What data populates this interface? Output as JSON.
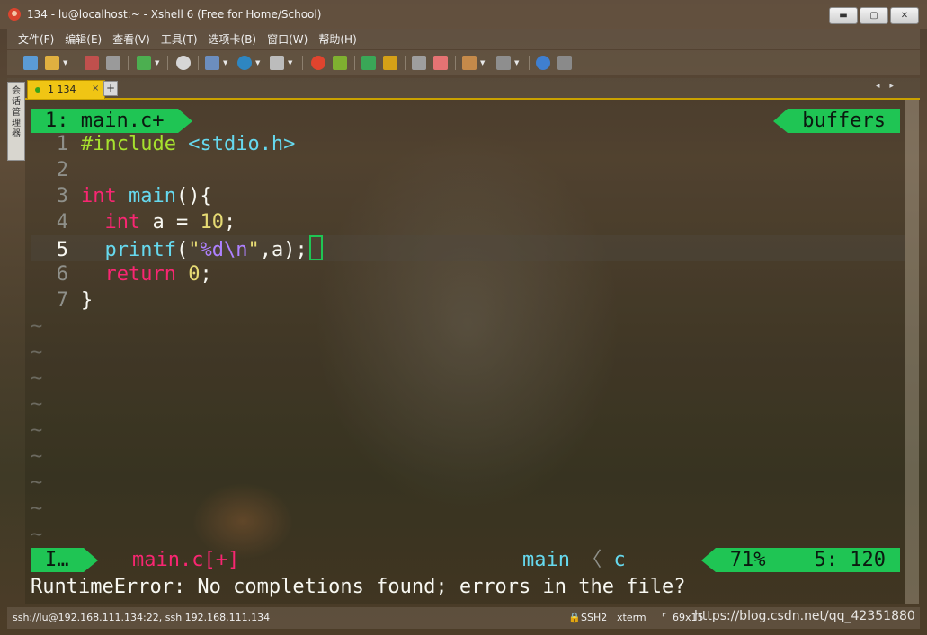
{
  "window": {
    "title": "134 - lu@localhost:~ - Xshell 6 (Free for Home/School)",
    "buttons": {
      "minimize": "▬",
      "maximize": "▢",
      "close": "✕"
    }
  },
  "menu": [
    "文件(F)",
    "编辑(E)",
    "查看(V)",
    "工具(T)",
    "选项卡(B)",
    "窗口(W)",
    "帮助(H)"
  ],
  "toolbar_icons": [
    "new-session-icon",
    "open-folder-icon",
    "connect-icon",
    "disconnect-icon",
    "new-window-icon",
    "find-icon",
    "properties-icon",
    "globe-icon",
    "font-icon",
    "xftp-icon",
    "xagent-icon",
    "fullscreen-icon",
    "lock-icon",
    "keyboard-icon",
    "highlight-icon",
    "compose-icon",
    "layout-icon",
    "help-icon",
    "chat-icon"
  ],
  "tabs": [
    {
      "label": "1 134",
      "close": "×"
    }
  ],
  "tab_add": "+",
  "tab_nav": "◂ ▸",
  "side_panel": {
    "label": "会话管理器"
  },
  "terminal": {
    "top_left": "1: main.c+",
    "top_right": "buffers",
    "lines": [
      {
        "n": "1",
        "tokens": [
          {
            "t": "#include ",
            "c": "k-pp"
          },
          {
            "t": "<stdio.h>",
            "c": "k-hdr"
          }
        ]
      },
      {
        "n": "2",
        "tokens": []
      },
      {
        "n": "3",
        "tokens": [
          {
            "t": "int",
            "c": "k-type"
          },
          {
            "t": " "
          },
          {
            "t": "main",
            "c": "k-fn"
          },
          {
            "t": "(){"
          }
        ]
      },
      {
        "n": "4",
        "tokens": [
          {
            "t": "  "
          },
          {
            "t": "int",
            "c": "k-type"
          },
          {
            "t": " a = "
          },
          {
            "t": "10",
            "c": "k-num"
          },
          {
            "t": ";"
          }
        ]
      },
      {
        "n": "5",
        "current": true,
        "tokens": [
          {
            "t": "  "
          },
          {
            "t": "printf",
            "c": "k-fn"
          },
          {
            "t": "("
          },
          {
            "t": "\"",
            "c": "k-str"
          },
          {
            "t": "%d\\n",
            "c": "k-esc"
          },
          {
            "t": "\"",
            "c": "k-str"
          },
          {
            "t": ",a);"
          }
        ]
      },
      {
        "n": "6",
        "tokens": [
          {
            "t": "  "
          },
          {
            "t": "return",
            "c": "k-kw"
          },
          {
            "t": " "
          },
          {
            "t": "0",
            "c": "k-num"
          },
          {
            "t": ";"
          }
        ]
      },
      {
        "n": "7",
        "tokens": [
          {
            "t": "}"
          }
        ]
      }
    ],
    "tilde_count": 9,
    "tilde": "~",
    "statusline": {
      "mode": "I…",
      "filename": "main.c[+]",
      "context_func": "main",
      "context_sep": "〈",
      "context_ft": "c",
      "percent": "71%",
      "position": "5: 120"
    },
    "message": "RuntimeError: No completions found; errors in the file?"
  },
  "status": {
    "connection": "ssh://lu@192.168.111.134:22, ssh 192.168.111.134",
    "protocol": "SSH2",
    "term": "xterm",
    "size": "69x15"
  },
  "watermark": "https://blog.csdn.net/qq_42351880",
  "colors": {
    "accent_green": "#1fc554",
    "tab_yellow": "#f0c514"
  }
}
